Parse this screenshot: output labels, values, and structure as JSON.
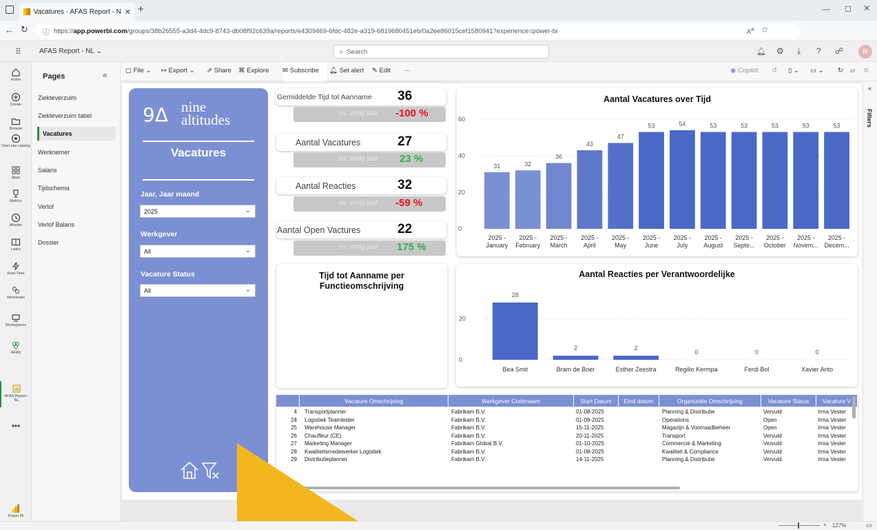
{
  "browser": {
    "tab_title": "Vacatures - AFAS Report - NL - Po",
    "url_prefix": "https://",
    "url_host": "app.powerbi.com",
    "url_path": "/groups/38b26555-a3d4-4dc9-8743-db08f92c639a/reports/e4309469-6fdc-482e-a319-6819680451eb/0a2ee86015cef1580941?experience=power-bi"
  },
  "header": {
    "report_name": "AFAS Report - NL",
    "search_placeholder": "Search"
  },
  "rail": {
    "items": [
      "Home",
      "Create",
      "Browse",
      "OneLake catalog",
      "Apps",
      "Metrics",
      "Monitor",
      "Learn",
      "Real-Time",
      "Workloads",
      "Workspaces",
      "AFAS",
      "AFAS Report - NL",
      "Power BI"
    ]
  },
  "pages_pane": {
    "title": "Pages",
    "items": [
      "Ziekteverzuim",
      "Ziekteverzuim tabel",
      "Vacatures",
      "Werknemer",
      "Salaris",
      "Tijdschema",
      "Verlof",
      "Verlof Balans",
      "Dossier"
    ]
  },
  "toolbar": {
    "file": "File",
    "export": "Export",
    "share": "Share",
    "explore": "Explore",
    "subscribe": "Subscribe",
    "set_alert": "Set alert",
    "edit": "Edit",
    "copilot": "Copilot",
    "filters": "Filters"
  },
  "slicer_panel": {
    "logo_mark": "9Δ",
    "logo_line1": "nine",
    "logo_line2": "altitudes",
    "page_title": "Vacatures",
    "year_label": "Jaar, Jaar maand",
    "year_value": "2025",
    "employer_label": "Werkgever",
    "employer_value": "All",
    "status_label": "Vacature Status",
    "status_value": "All"
  },
  "kpis": [
    {
      "label": "Gemiddelde Tijd tot Aanname",
      "value": "36",
      "vs_label": "vs. vorig jaar",
      "delta": "-100 %",
      "delta_color": "#e81123"
    },
    {
      "label": "Aantal Vacatures",
      "value": "27",
      "vs_label": "vs. vorig jaar",
      "delta": "23 %",
      "delta_color": "#2db14f"
    },
    {
      "label": "Aantal Reacties",
      "value": "32",
      "vs_label": "vs. vorig jaar",
      "delta": "-59 %",
      "delta_color": "#e81123"
    },
    {
      "label": "Aantal Open Vactures",
      "value": "22",
      "vs_label": "vs. vorig jaar",
      "delta": "175 %",
      "delta_color": "#2db14f"
    }
  ],
  "chart_titles": {
    "vacatures_over_tijd": "Aantal Vacatures over Tijd",
    "tijd_tot_aanname": "Tijd tot Aanname per Functieomschrijving",
    "reacties_per_verantwoordelijke": "Aantal Reacties per Verantwoordelijke"
  },
  "chart_data": [
    {
      "type": "bar",
      "title": "Aantal Vacatures over Tijd",
      "categories": [
        "2025 - January",
        "2025 - February",
        "2025 - March",
        "2025 - April",
        "2025 - May",
        "2025 - June",
        "2025 - July",
        "2025 - August",
        "2025 - Septe...",
        "2025 - October",
        "2025 - Novem...",
        "2025 - Decem..."
      ],
      "values": [
        31,
        32,
        36,
        43,
        47,
        53,
        54,
        53,
        53,
        53,
        53,
        53
      ],
      "ylim": [
        0,
        60
      ],
      "yticks": [
        0,
        20,
        40,
        60
      ],
      "colors": [
        "#7b8fd3",
        "#7b8fd3",
        "#7186d0",
        "#6078cc",
        "#5570c9",
        "#4a68c6",
        "#4a68c6",
        "#4a68c6",
        "#4a68c6",
        "#4a68c6",
        "#4a68c6",
        "#4a68c6"
      ],
      "grid": true
    },
    {
      "type": "bar",
      "title": "Aantal Reacties per Verantwoordelijke",
      "categories": [
        "Bea Smit",
        "Bram de Boer",
        "Esther Zeestra",
        "Regilio Kermpa",
        "Ferdi Bol",
        "Xavier Anto"
      ],
      "values": [
        28,
        2,
        2,
        0,
        0,
        0
      ],
      "ylim": [
        0,
        30
      ],
      "yticks": [
        0,
        20
      ],
      "color": "#4a68c6",
      "grid": true
    }
  ],
  "table": {
    "columns": [
      "",
      "Vacature Omschrijving",
      "Werkgever Codenaam",
      "Start Datum",
      "Eind datum",
      "Organizatie Omschrijving",
      "Vacature Status",
      "Vacature V"
    ],
    "rows": [
      [
        "4",
        "Transportplanner",
        "Fabrikam B.V.",
        "01-08-2025",
        "",
        "Planning & Distributie",
        "Vervuld",
        "Irma Vester"
      ],
      [
        "24",
        "Logistiek Teamleider",
        "Fabrikam B.V.",
        "01-09-2025",
        "",
        "Operations",
        "Open",
        "Irma Vester"
      ],
      [
        "25",
        "Warehouse Manager",
        "Fabrikam B.V.",
        "15-11-2025",
        "",
        "Magazijn & Voorraadbeheer",
        "Open",
        "Irma Vester"
      ],
      [
        "26",
        "Chauffeur (CE)",
        "Fabrikam B.V.",
        "20-11-2025",
        "",
        "Transport",
        "Vervuld",
        "Irma Vester"
      ],
      [
        "27",
        "Marketing Manager",
        "Fabrikam Global B.V.",
        "01-10-2025",
        "",
        "Commercie & Marketing",
        "Vervuld",
        "Irma Vester"
      ],
      [
        "28",
        "Kwaliteitsmedewerker Logistiek",
        "Fabrikam B.V.",
        "01-08-2025",
        "",
        "Kwaliteit & Compliance",
        "Vervuld",
        "Irma Vester"
      ],
      [
        "29",
        "Distributieplanner",
        "Fabrikam B.V.",
        "14-11-2025",
        "",
        "Planning & Distributie",
        "Vervuld",
        "Irma Vester"
      ]
    ]
  },
  "status": {
    "zoom": "127%"
  }
}
